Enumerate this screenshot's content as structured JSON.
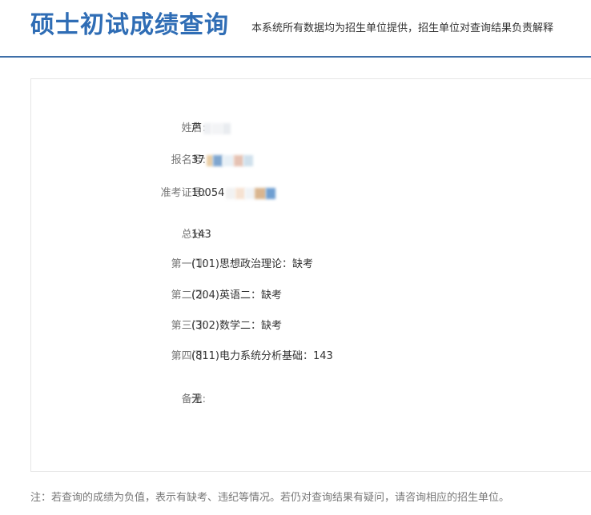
{
  "header": {
    "title": "硕士初试成绩查询",
    "note": "本系统所有数据均为招生单位提供，招生单位对查询结果负责解释"
  },
  "result": {
    "name_label": "姓名:",
    "name_value": "芦",
    "reg_label": "报名号:",
    "reg_value": "37",
    "exam_label": "准考证号:",
    "exam_value": "10054",
    "total_label": "总分:",
    "total_value": "143",
    "subjects": [
      {
        "label": "第一门:",
        "value": "(101)思想政治理论：缺考"
      },
      {
        "label": "第二门:",
        "value": "(204)英语二：缺考"
      },
      {
        "label": "第三门:",
        "value": "(302)数学二：缺考"
      },
      {
        "label": "第四门:",
        "value": "(811)电力系统分析基础：143"
      }
    ],
    "remark_label": "备注:",
    "remark_value": "无"
  },
  "footer": {
    "note": "注：若查询的成绩为负值，表示有缺考、违纪等情况。若仍对查询结果有疑问，请咨询相应的招生单位。"
  },
  "colors": {
    "accent": "#2f6db5",
    "divider": "#3e6fa8",
    "label": "#777777",
    "text": "#333333"
  }
}
